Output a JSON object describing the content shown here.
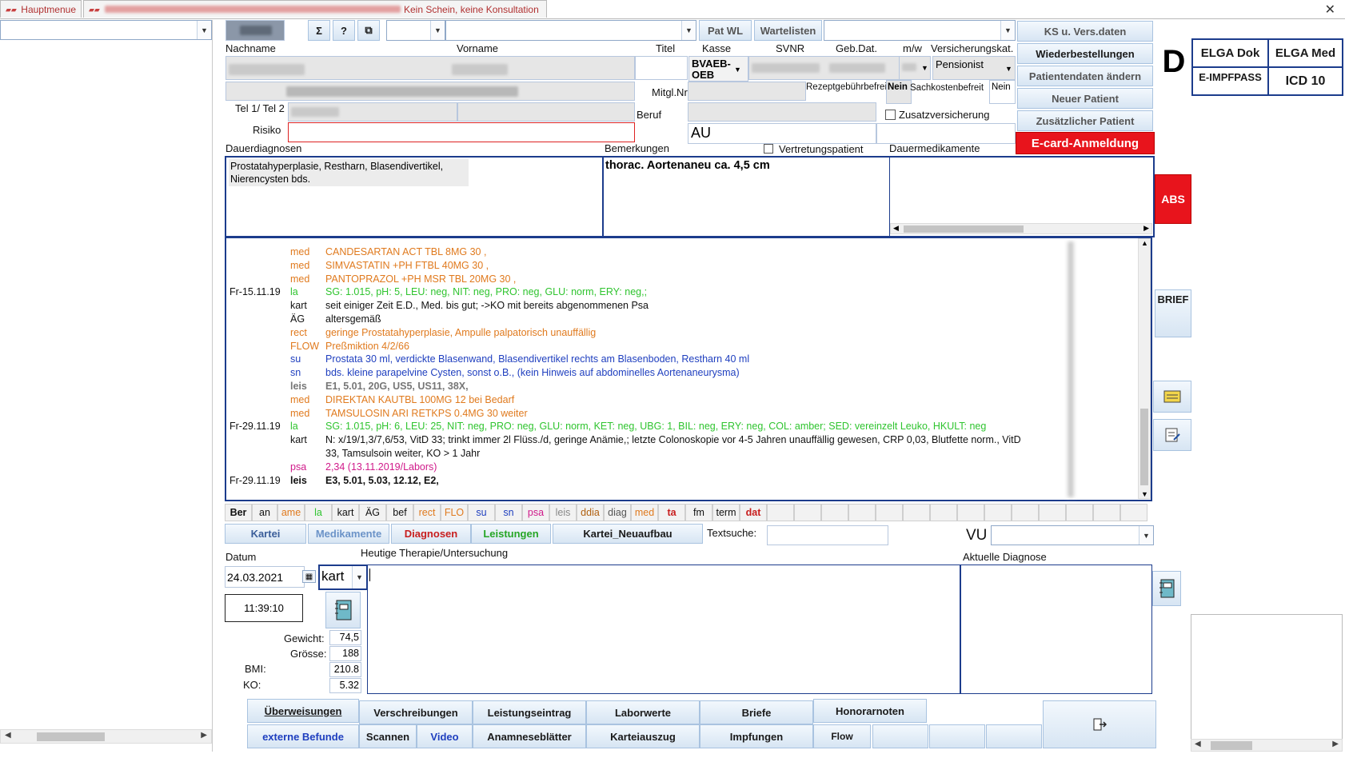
{
  "tabs": {
    "main_label": "Hauptmenue",
    "patient_label": "Kein Schein, keine Konsultation"
  },
  "close_glyph": "✕",
  "toolbar": {
    "sigma_symbol": "Σ",
    "help_symbol": "?",
    "copy_symbol": "⧉",
    "pat_wl_label": "Pat WL",
    "wartelisten_label": "Wartelisten"
  },
  "right_menu": {
    "ks_label": "KS u. Vers.daten",
    "wiederbestellungen_label": "Wiederbestellungen",
    "patientendaten_label": "Patientendaten ändern",
    "neuer_patient_label": "Neuer Patient",
    "zusaetzlicher_patient_label": "Zusätzlicher Patient",
    "ecard_label": "E-card-Anmeldung"
  },
  "header_labels": {
    "nachname": "Nachname",
    "vorname": "Vorname",
    "titel": "Titel",
    "kasse": "Kasse",
    "svnr": "SVNR",
    "gebdat": "Geb.Dat.",
    "mw": "m/w",
    "versicherungskat": "Versicherungskat.",
    "mitglnr": "Mitgl.Nr",
    "rezeptgebuehr": "Rezeptgebührbefreit",
    "sachkosten": "Sachkostenbefreit",
    "tel": "Tel 1/ Tel 2",
    "beruf": "Beruf",
    "risiko": "Risiko",
    "zusatzversicherung": "Zusatzversicherung",
    "vertretungspatient": "Vertretungspatient",
    "dauerdiagnosen": "Dauerdiagnosen",
    "bemerkungen": "Bemerkungen",
    "dauermedikamente": "Dauermedikamente"
  },
  "patient": {
    "kasse": "BVAEB-OEB",
    "versicherungskat": "Pensionist",
    "rezeptgebuehr_value": "Nein",
    "sachkosten_value": "Nein",
    "beruf_value": "AU",
    "dauerdiagnosen_text": "Prostatahyperplasie, Restharn, Blasendivertikel, Nierencysten bds.",
    "bemerkungen_text": "thorac. Aortenaneu ca. 4,5 cm"
  },
  "side": {
    "d_letter": "D",
    "elga_dok": "ELGA Dok",
    "elga_med": "ELGA Med",
    "eimpfpass": "E-IMPFPASS",
    "icd10": "ICD 10",
    "abs": "ABS",
    "brief": "BRIEF"
  },
  "journal": [
    {
      "date": "",
      "type": "med",
      "text": "CANDESARTAN ACT TBL  8MG 30 ,",
      "color": "#e07a1e",
      "bold": false
    },
    {
      "date": "",
      "type": "med",
      "text": "SIMVASTATIN +PH FTBL 40MG 30 ,",
      "color": "#e07a1e",
      "bold": false
    },
    {
      "date": "",
      "type": "med",
      "text": "PANTOPRAZOL +PH MSR TBL 20MG 30 ,",
      "color": "#e07a1e",
      "bold": false
    },
    {
      "date": "Fr-15.11.19",
      "type": "la",
      "text": "SG: 1.015, pH: 5, LEU: neg, NIT: neg, PRO: neg, GLU: norm, ERY: neg,;",
      "color": "#2fc42f",
      "bold": false
    },
    {
      "date": "",
      "type": "kart",
      "text": "seit einiger Zeit E.D., Med.                                              bis gut; ->KO mit bereits abgenommenen Psa",
      "color": "#111111",
      "bold": false
    },
    {
      "date": "",
      "type": "ÄG",
      "text": "altersgemäß",
      "color": "#111111",
      "bold": false
    },
    {
      "date": "",
      "type": "rect",
      "text": "geringe Prostatahyperplasie, Ampulle palpatorisch unauffällig",
      "color": "#e07a1e",
      "bold": false
    },
    {
      "date": "",
      "type": "FLOW",
      "text": "Preßmiktion 4/2/66",
      "color": "#e07a1e",
      "bold": false
    },
    {
      "date": "",
      "type": "su",
      "text": "Prostata 30 ml, verdickte Blasenwand, Blasendivertikel rechts am Blasenboden, Restharn 40 ml",
      "color": "#1f3fbf",
      "bold": false
    },
    {
      "date": "",
      "type": "sn",
      "text": "bds. kleine parapelvine Cysten, sonst o.B., (kein Hinweis auf abdominelles Aortenaneurysma)",
      "color": "#1f3fbf",
      "bold": false
    },
    {
      "date": "",
      "type": "leis",
      "text": "E1, 5.01, 20G, US5, US11, 38X,",
      "color": "#777777",
      "bold": true
    },
    {
      "date": "",
      "type": "med",
      "text": "DIREKTAN KAUTBL 100MG 12   bei Bedarf",
      "color": "#e07a1e",
      "bold": false
    },
    {
      "date": "",
      "type": "med",
      "text": "TAMSULOSIN ARI RETKPS 0.4MG 30  weiter",
      "color": "#e07a1e",
      "bold": false
    },
    {
      "date": "Fr-29.11.19",
      "type": "la",
      "text": "SG: 1.015, pH: 6, LEU: 25, NIT: neg, PRO: neg, GLU: norm, KET: neg, UBG: 1, BIL: neg, ERY: neg, COL: amber; SED: vereinzelt Leuko, HKULT: neg",
      "color": "#2fc42f",
      "bold": false
    },
    {
      "date": "",
      "type": "kart",
      "text": "N: x/19/1,3/7,6/53, VitD 33; trinkt immer 2l Flüss./d, geringe Anämie,; letzte Colonoskopie vor 4-5 Jahren unauffällig gewesen, CRP 0,03, Blutfette norm., VitD",
      "color": "#111111",
      "bold": false
    },
    {
      "date": "",
      "type": "",
      "text": "33, Tamsulsoin weiter, KO > 1 Jahr",
      "color": "#111111",
      "bold": false
    },
    {
      "date": "",
      "type": "psa",
      "text": "2,34    (13.11.2019/Labors)",
      "color": "#d01a8a",
      "bold": false
    },
    {
      "date": "Fr-29.11.19",
      "type": "leis",
      "text": "E3, 5.01, 5.03, 12.12, E2,",
      "color": "#111111",
      "bold": true
    }
  ],
  "entry_tags": [
    {
      "label": "Ber",
      "color": "#111111",
      "bold": true
    },
    {
      "label": "an",
      "color": "#111111",
      "bold": false
    },
    {
      "label": "ame",
      "color": "#e07a1e",
      "bold": false
    },
    {
      "label": "la",
      "color": "#2fc42f",
      "bold": false
    },
    {
      "label": "kart",
      "color": "#111111",
      "bold": false
    },
    {
      "label": "ÄG",
      "color": "#111111",
      "bold": false
    },
    {
      "label": "bef",
      "color": "#111111",
      "bold": false
    },
    {
      "label": "rect",
      "color": "#e07a1e",
      "bold": false
    },
    {
      "label": "FLO",
      "color": "#e07a1e",
      "bold": false
    },
    {
      "label": "su",
      "color": "#1f3fbf",
      "bold": false
    },
    {
      "label": "sn",
      "color": "#1f3fbf",
      "bold": false
    },
    {
      "label": "psa",
      "color": "#d01a8a",
      "bold": false
    },
    {
      "label": "leis",
      "color": "#888888",
      "bold": false
    },
    {
      "label": "ddia",
      "color": "#b06010",
      "bold": false
    },
    {
      "label": "diag",
      "color": "#555555",
      "bold": false
    },
    {
      "label": "med",
      "color": "#e07a1e",
      "bold": false
    },
    {
      "label": "ta",
      "color": "#c81e1e",
      "bold": true
    },
    {
      "label": "fm",
      "color": "#111111",
      "bold": false
    },
    {
      "label": "term",
      "color": "#111111",
      "bold": false
    },
    {
      "label": "dat",
      "color": "#c81e1e",
      "bold": true
    }
  ],
  "view_tabs": {
    "kartei": "Kartei",
    "medikamente": "Medikamente",
    "diagnosen": "Diagnosen",
    "leistungen": "Leistungen",
    "neuaufbau": "Kartei_Neuaufbau",
    "textsuche_label": "Textsuche:",
    "vu_label": "VU"
  },
  "entry": {
    "datum_label": "Datum",
    "datum_value": "24.03.2021",
    "type_value": "kart",
    "time_value": "11:39:10",
    "therapie_label": "Heutige Therapie/Untersuchung",
    "diagnose_label": "Aktuelle Diagnose",
    "gewicht_label": "Gewicht:",
    "gewicht_value": "74,5",
    "groesse_label": "Grösse:",
    "groesse_value": "188",
    "bmi_label": "BMI:",
    "bmi_value": "210.8",
    "ko_label": "KO:",
    "ko_value": "5.32"
  },
  "bottom_buttons": {
    "ueberweisungen": "Überweisungen",
    "verschreibungen": "Verschreibungen",
    "leistungseintrag": "Leistungseintrag",
    "laborwerte": "Laborwerte",
    "briefe": "Briefe",
    "honorarnoten": "Honorarnoten",
    "externe_befunde": "externe Befunde",
    "scannen": "Scannen",
    "video": "Video",
    "anamneseblaetter": "Anamneseblätter",
    "karteiauszug": "Karteiauszug",
    "impfungen": "Impfungen",
    "flow": "Flow"
  }
}
